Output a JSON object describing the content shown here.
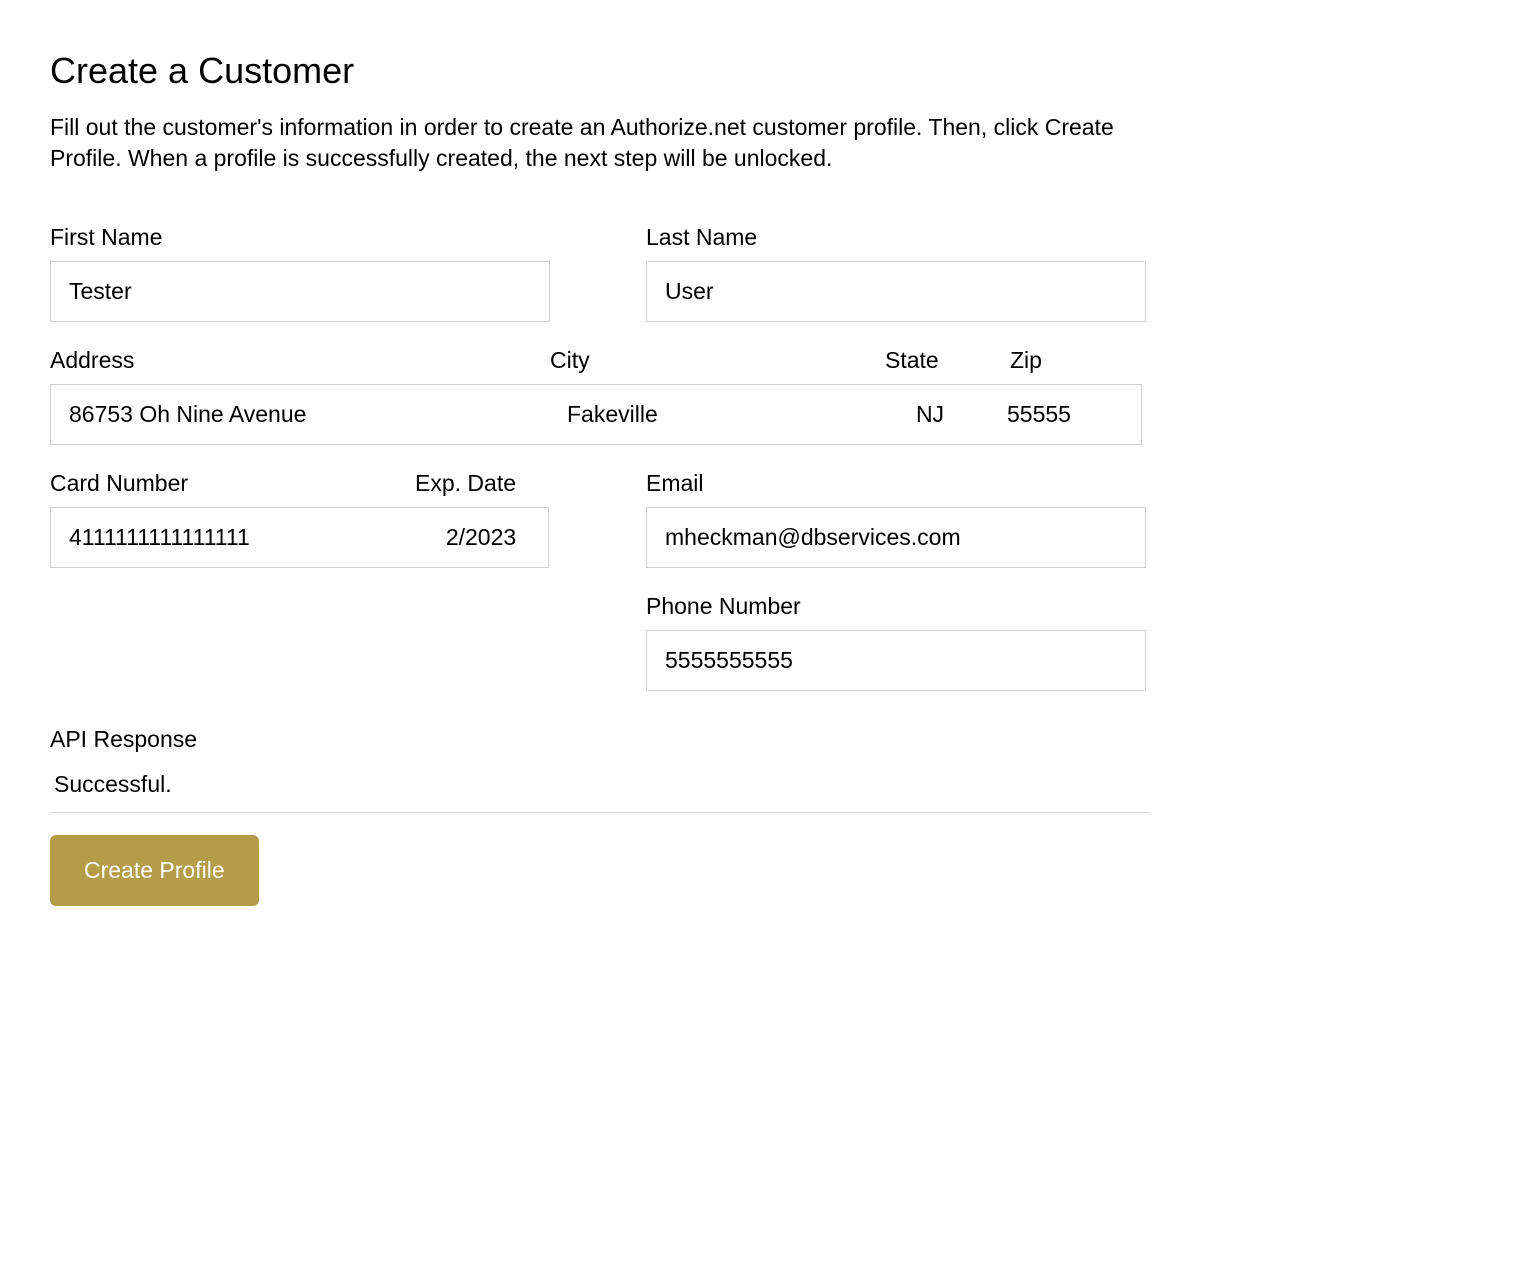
{
  "page": {
    "title": "Create a Customer",
    "description": "Fill out the customer's information in order to create an Authorize.net customer profile. Then, click Create Profile. When a profile is successfully created, the next step will be unlocked."
  },
  "labels": {
    "first_name": "First Name",
    "last_name": "Last Name",
    "address": "Address",
    "city": "City",
    "state": "State",
    "zip": "Zip",
    "card_number": "Card Number",
    "exp_date": "Exp. Date",
    "email": "Email",
    "phone": "Phone Number",
    "api_response": "API Response"
  },
  "form": {
    "first_name": "Tester",
    "last_name": "User",
    "address": "86753 Oh Nine Avenue",
    "city": "Fakeville",
    "state": "NJ",
    "zip": "55555",
    "card_number": "4111111111111111",
    "exp_date": "2/2023",
    "email": "mheckman@dbservices.com",
    "phone": "5555555555"
  },
  "api": {
    "response": "Successful."
  },
  "buttons": {
    "create_profile": "Create Profile"
  }
}
